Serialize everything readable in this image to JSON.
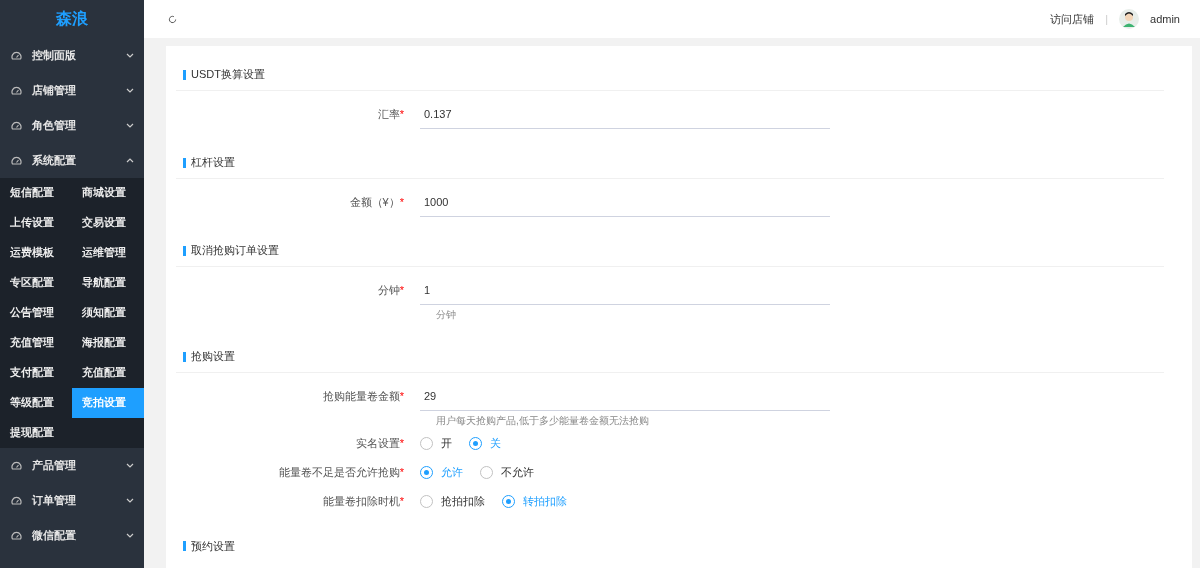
{
  "sidebar": {
    "logo": "森浪",
    "menus": [
      {
        "label": "控制面版",
        "expanded": false
      },
      {
        "label": "店铺管理",
        "expanded": false
      },
      {
        "label": "角色管理",
        "expanded": false
      },
      {
        "label": "系统配置",
        "expanded": true,
        "children": [
          {
            "label": "短信配置",
            "selected": false
          },
          {
            "label": "商城设置",
            "selected": false
          },
          {
            "label": "上传设置",
            "selected": false
          },
          {
            "label": "交易设置",
            "selected": false
          },
          {
            "label": "运费模板",
            "selected": false
          },
          {
            "label": "运维管理",
            "selected": false
          },
          {
            "label": "专区配置",
            "selected": false
          },
          {
            "label": "导航配置",
            "selected": false
          },
          {
            "label": "公告管理",
            "selected": false
          },
          {
            "label": "须知配置",
            "selected": false
          },
          {
            "label": "充值管理",
            "selected": false
          },
          {
            "label": "海报配置",
            "selected": false
          },
          {
            "label": "支付配置",
            "selected": false
          },
          {
            "label": "充值配置",
            "selected": false
          },
          {
            "label": "等级配置",
            "selected": false
          },
          {
            "label": "竞拍设置",
            "selected": true
          },
          {
            "label": "提现配置",
            "selected": false
          }
        ]
      },
      {
        "label": "产品管理",
        "expanded": false
      },
      {
        "label": "订单管理",
        "expanded": false
      },
      {
        "label": "微信配置",
        "expanded": false
      }
    ]
  },
  "topbar": {
    "visit_store": "访问店铺",
    "separator": "|",
    "user": "admin"
  },
  "sections": [
    {
      "title": "USDT换算设置",
      "fields": [
        {
          "kind": "input",
          "label": "汇率",
          "required_mark": "*",
          "value": "0.137"
        }
      ]
    },
    {
      "title": "杠杆设置",
      "fields": [
        {
          "kind": "input",
          "label": "金额（¥）",
          "required_mark": "*",
          "value": "1000"
        }
      ]
    },
    {
      "title": "取消抢购订单设置",
      "fields": [
        {
          "kind": "input",
          "label": "分钟",
          "required_mark": "*",
          "value": "1",
          "hint": "分钟"
        }
      ]
    },
    {
      "title": "抢购设置",
      "fields": [
        {
          "kind": "input",
          "label": "抢购能量卷金额",
          "required_mark": "*",
          "value": "29",
          "hint": "用户每天抢购产品,低于多少能量卷金额无法抢购"
        },
        {
          "kind": "radio",
          "label": "实名设置",
          "required_mark": "*",
          "options": [
            {
              "label": "开",
              "selected": false
            },
            {
              "label": "关",
              "selected": true
            }
          ]
        },
        {
          "kind": "radio",
          "label": "能量卷不足是否允许抢购",
          "required_mark": "*",
          "options": [
            {
              "label": "允许",
              "selected": true
            },
            {
              "label": "不允许",
              "selected": false
            }
          ]
        },
        {
          "kind": "radio",
          "label": "能量卷扣除时机",
          "required_mark": "*",
          "options": [
            {
              "label": "抢拍扣除",
              "selected": false
            },
            {
              "label": "转拍扣除",
              "selected": true
            }
          ]
        }
      ]
    },
    {
      "title": "预约设置"
    }
  ]
}
